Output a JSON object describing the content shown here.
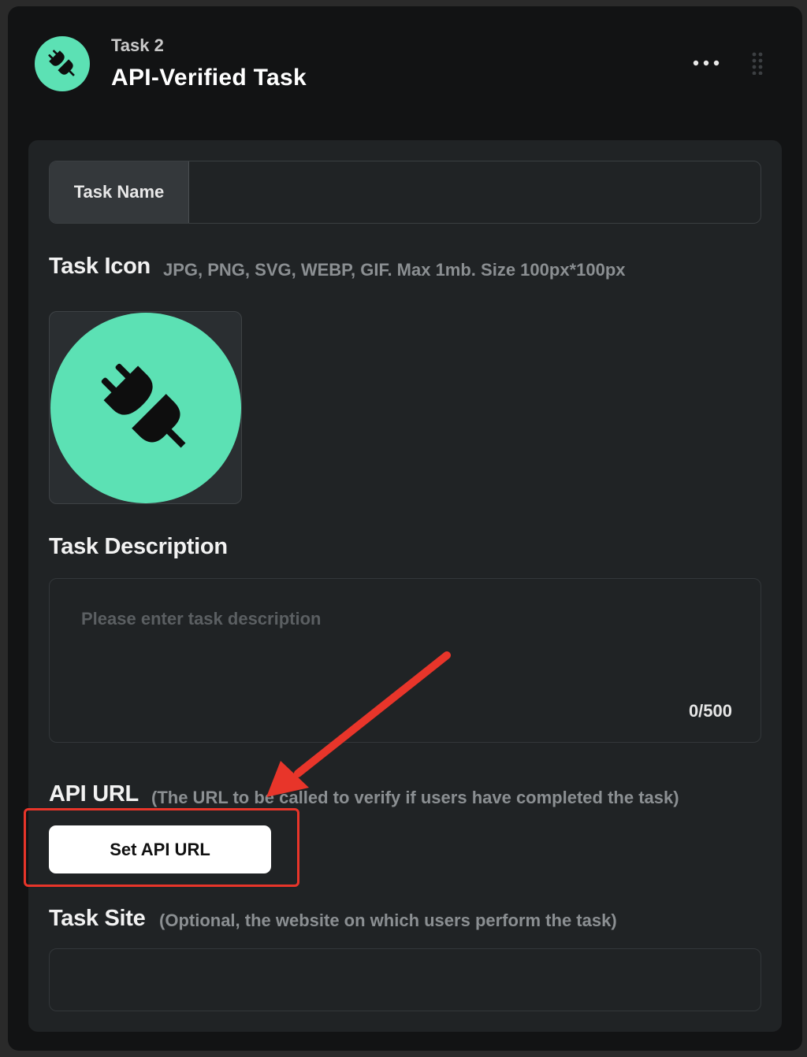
{
  "header": {
    "subtitle": "Task 2",
    "title": "API-Verified Task",
    "avatar_icon": "plug-icon",
    "more_icon": "more-horizontal-icon",
    "drag_icon": "drag-handle-icon",
    "accent_color": "#5ce1b4"
  },
  "task_name": {
    "label": "Task Name",
    "value": ""
  },
  "task_icon": {
    "title": "Task Icon",
    "hint": "JPG, PNG, SVG, WEBP, GIF. Max 1mb. Size 100px*100px",
    "icon": "plug-icon"
  },
  "task_description": {
    "title": "Task Description",
    "placeholder": "Please enter task description",
    "value": "",
    "counter": "0/500"
  },
  "api_url": {
    "title": "API URL",
    "hint": "(The URL to be called to verify if users have completed the task)",
    "button_label": "Set API URL"
  },
  "task_site": {
    "title": "Task Site",
    "hint": "(Optional, the website on which users perform the task)",
    "value": ""
  },
  "annotation": {
    "color": "#e8352a",
    "type": "arrow-and-box"
  }
}
